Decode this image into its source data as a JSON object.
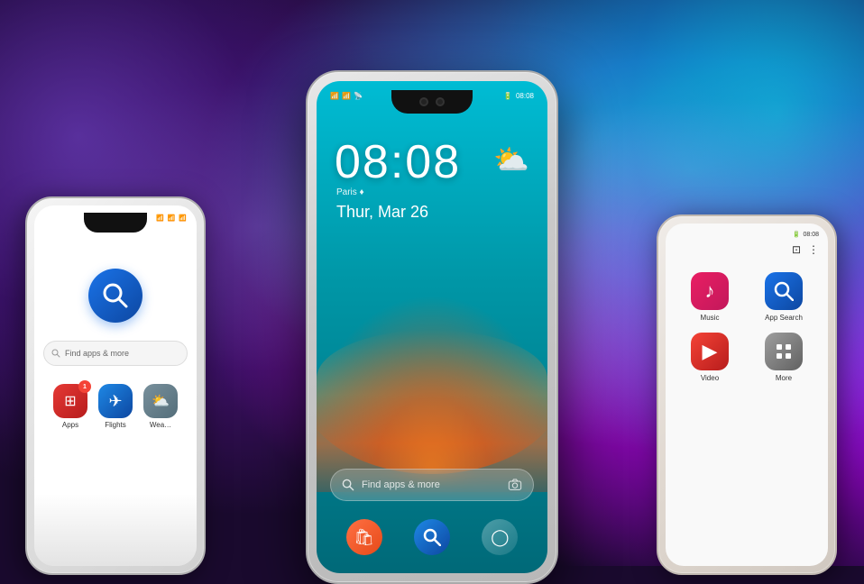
{
  "background": {
    "colorLeft": "#6b3fa0",
    "colorRight": "#00bcd4",
    "colorAccent": "#9c27b0"
  },
  "phoneLeft": {
    "searchIconLabel": "🔍",
    "searchPlaceholder": "Find apps & more",
    "apps": [
      {
        "name": "Apps",
        "emoji": "🟥",
        "badge": "1",
        "color": "apps-red"
      },
      {
        "name": "Flights",
        "emoji": "✈️",
        "badge": null,
        "color": "flights-blue"
      },
      {
        "name": "Wea…",
        "emoji": "☁️",
        "badge": null,
        "color": "weather-gray"
      }
    ],
    "statusIcons": "📶 📶 📶 🔋"
  },
  "phoneCenter": {
    "time": "08:08",
    "date": "Thur, Mar 26",
    "location": "Paris ♦",
    "weatherIcon": "⛅",
    "searchPlaceholder": "Find apps & more",
    "statusTime": "08:08",
    "bottomIcons": [
      "🛍️",
      "🔵",
      "⭕"
    ]
  },
  "phoneRight": {
    "statusTime": "08:08",
    "apps": [
      {
        "name": "Music",
        "emoji": "🎵",
        "iconClass": "music-icon"
      },
      {
        "name": "App Search",
        "emoji": "🔍",
        "iconClass": "appsearch-icon"
      },
      {
        "name": "Video",
        "emoji": "▶",
        "iconClass": "video-icon"
      },
      {
        "name": "More",
        "emoji": "⠿",
        "iconClass": "more-icon"
      }
    ]
  }
}
